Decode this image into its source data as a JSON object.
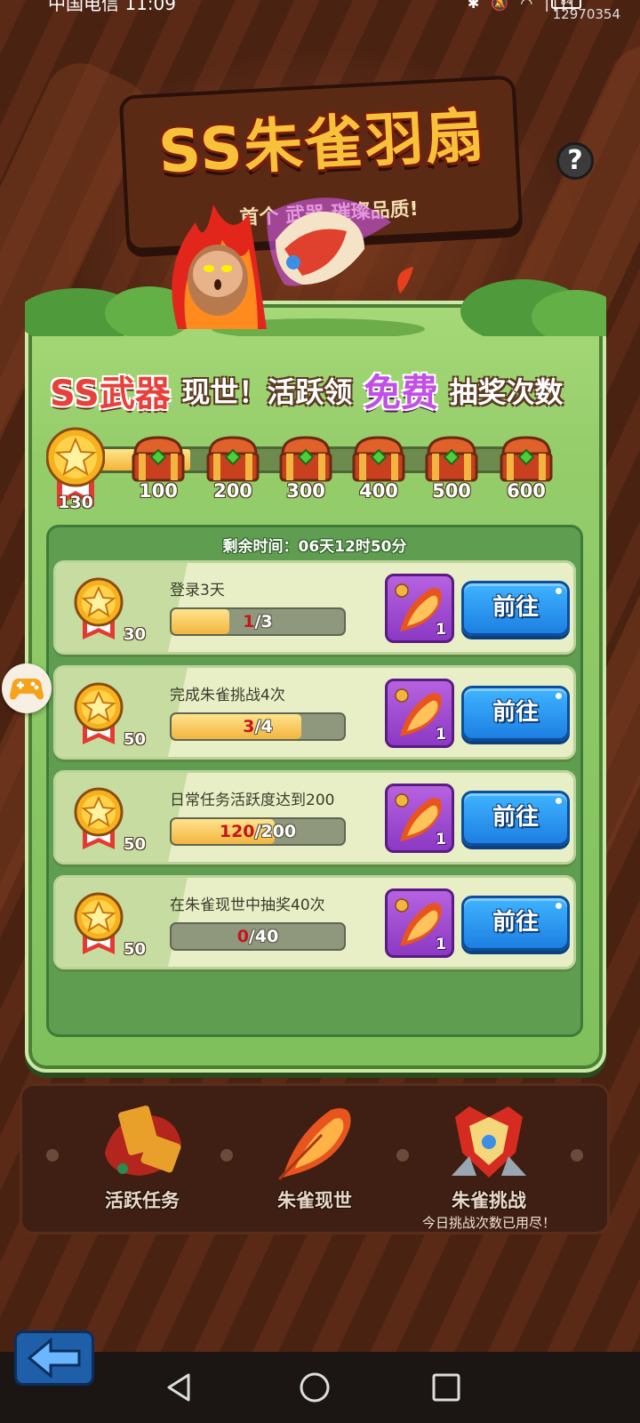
{
  "status_bar": {
    "carrier_time": "中国电信 11:09",
    "battery": "84",
    "user_id": "12970354"
  },
  "title": {
    "main": "SS朱雀羽扇",
    "subtitle": "首个  武器    璀璨品质!"
  },
  "help_label": "?",
  "headline": {
    "part1": "SS武器",
    "part2": "现世！活跃领",
    "part3": "免费",
    "part4": "抽奖次数"
  },
  "progress": {
    "current": "130",
    "current_value": 130,
    "max_value": 600,
    "milestones": [
      "100",
      "200",
      "300",
      "400",
      "500",
      "600"
    ]
  },
  "timer": "剩余时间：06天12时50分",
  "tasks": [
    {
      "points": "30",
      "desc": "登录3天",
      "cur": "1",
      "total": "/3",
      "fraction": 0.333,
      "reward_qty": "1",
      "button": "前往"
    },
    {
      "points": "50",
      "desc": "完成朱雀挑战4次",
      "cur": "3",
      "total": "/4",
      "fraction": 0.75,
      "reward_qty": "1",
      "button": "前往"
    },
    {
      "points": "50",
      "desc": "日常任务活跃度达到200",
      "cur": "120",
      "total": "/200",
      "fraction": 0.6,
      "reward_qty": "1",
      "button": "前往"
    },
    {
      "points": "50",
      "desc": "在朱雀现世中抽奖40次",
      "cur": "0",
      "total": "/40",
      "fraction": 0,
      "reward_qty": "1",
      "button": "前往"
    }
  ],
  "tabs": [
    {
      "label": "活跃任务",
      "sub": ""
    },
    {
      "label": "朱雀现世",
      "sub": ""
    },
    {
      "label": "朱雀挑战",
      "sub": "今日挑战次数已用尽！"
    }
  ],
  "colors": {
    "panel_green": "#95cd6b",
    "go_blue": "#1d7fe2",
    "reward_purple": "#8c39c4",
    "accent_red": "#e8403a"
  }
}
